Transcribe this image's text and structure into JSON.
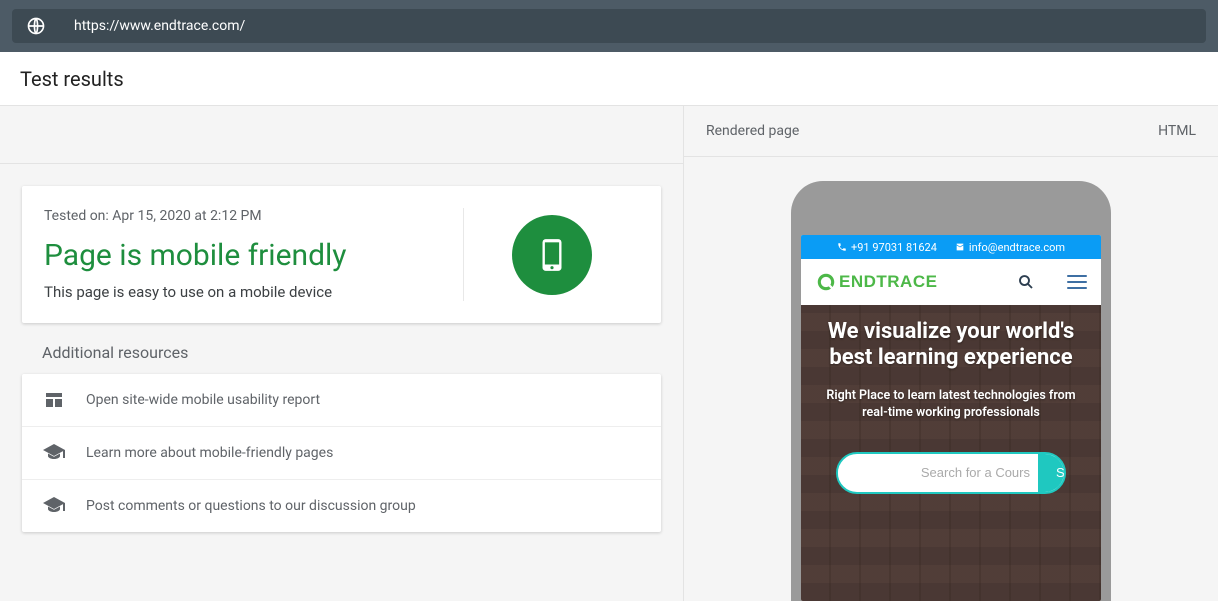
{
  "url_bar": {
    "value": "https://www.endtrace.com/"
  },
  "header": {
    "title": "Test results"
  },
  "result": {
    "tested_label": "Tested on: Apr 15, 2020 at 2:12 PM",
    "title": "Page is mobile friendly",
    "subtitle": "This page is easy to use on a mobile device"
  },
  "resources": {
    "heading": "Additional resources",
    "items": [
      "Open site-wide mobile usability report",
      "Learn more about mobile-friendly pages",
      "Post comments or questions to our discussion group"
    ]
  },
  "right": {
    "rendered_label": "Rendered page",
    "html_label": "HTML"
  },
  "preview": {
    "phone": "+91 97031 81624",
    "email": "info@endtrace.com",
    "logo": "ENDTRACE",
    "hero_title": "We visualize your world's best learning experience",
    "hero_sub": "Right Place to learn latest technologies from real-time working professionals",
    "search_placeholder": "Search for a Cours",
    "search_button": "Search"
  }
}
